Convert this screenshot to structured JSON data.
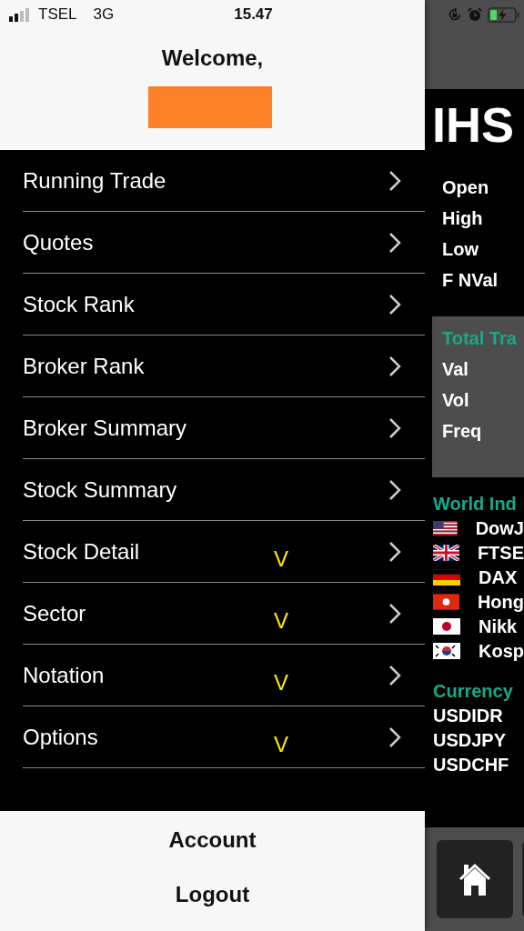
{
  "status_bar": {
    "carrier": "TSEL",
    "network": "3G",
    "time": "15.47"
  },
  "drawer": {
    "greeting": "Welcome,",
    "menu": [
      {
        "label": "Running Trade"
      },
      {
        "label": "Quotes"
      },
      {
        "label": "Stock Rank"
      },
      {
        "label": "Broker Rank"
      },
      {
        "label": "Broker Summary"
      },
      {
        "label": "Stock Summary"
      },
      {
        "label": "Stock Detail",
        "mark": "V"
      },
      {
        "label": "Sector",
        "mark": "V"
      },
      {
        "label": "Notation",
        "mark": "V"
      },
      {
        "label": "Options",
        "mark": "V"
      }
    ],
    "footer": [
      "Account",
      "Logout"
    ]
  },
  "background_screen": {
    "index_title": "IHS",
    "stats": [
      "Open",
      "High",
      "Low",
      "F NVal"
    ],
    "total_trade": {
      "title": "Total Tra",
      "rows": [
        "Val",
        "Vol",
        "Freq"
      ]
    },
    "world_indices": {
      "title": "World Ind",
      "items": [
        {
          "kind": "us",
          "name": "DowJ"
        },
        {
          "kind": "uk",
          "name": "FTSE"
        },
        {
          "kind": "de",
          "name": "DAX"
        },
        {
          "kind": "hk",
          "name": "Hong"
        },
        {
          "kind": "jp",
          "name": "Nikk"
        },
        {
          "kind": "kr",
          "name": "Kosp"
        }
      ]
    },
    "currency": {
      "title": "Currency",
      "items": [
        "USDIDR",
        "USDJPY",
        "USDCHF"
      ]
    }
  }
}
